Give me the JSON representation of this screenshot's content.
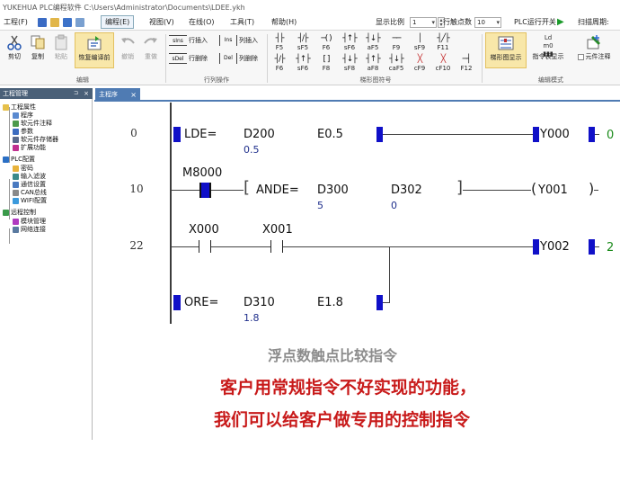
{
  "window": {
    "title": "YUKEHUA PLC编程软件 C:\\Users\\Administrator\\Documents\\LDEE.ykh"
  },
  "menu": {
    "items": [
      "工程(F)",
      "编程(E)",
      "视图(V)",
      "在线(O)",
      "工具(T)",
      "帮助(H)"
    ],
    "display_ratio_label": "显示比例",
    "display_ratio_value": "1",
    "row_points_label": "行触点数",
    "row_points_value": "10",
    "plc_switch_label": "PLC运行开关",
    "scan_cycle_label": "扫描周期:"
  },
  "ribbon": {
    "edit": {
      "cut": "剪切",
      "copy": "复制",
      "paste": "粘贴",
      "restore": "恢复编译前",
      "undo": "撤销",
      "redo": "重做",
      "group": "编辑"
    },
    "row_ops": {
      "row_insert": "行插入",
      "row_delete": "行删除",
      "col_insert": "列插入",
      "col_delete": "列删除",
      "ins_code1": "sIns",
      "del_code1": "sDel",
      "ins_code2": "Ins",
      "del_code2": "Del",
      "group": "行列操作"
    },
    "ladder": {
      "row1": [
        "F5",
        "sF5",
        "F6",
        "sF6",
        "aF5",
        "F9",
        "sF9",
        "F11"
      ],
      "row1_glyphs": [
        "┤├",
        "┤/├",
        "─( )",
        "┤↑├",
        "┤↓├",
        "──",
        "│",
        "┤╱├"
      ],
      "row2": [
        "F6",
        "sF6",
        "F8",
        "sF8",
        "aF8",
        "caF5",
        "cF9",
        "cF10",
        "F12"
      ],
      "row2_glyphs": [
        "┤/├",
        "┤↑├",
        "[ ]",
        "┤↓├",
        "┤↑├",
        "┤↓├",
        "╳",
        "╳",
        "─┤"
      ],
      "group": "梯形图符号"
    },
    "mode": {
      "ladder_display": "梯形图显示",
      "instr_display": "指令表显示",
      "comment_check": "元件注释",
      "ld_code": "Ld m0",
      "group": "编辑模式"
    }
  },
  "panel": {
    "title": "工程管理",
    "tree": [
      {
        "label": "工程属性",
        "indent": 0
      },
      {
        "label": "程序",
        "indent": 1
      },
      {
        "label": "软元件注释",
        "indent": 1
      },
      {
        "label": "参数",
        "indent": 1
      },
      {
        "label": "软元件存储器",
        "indent": 1
      },
      {
        "label": "扩展功能",
        "indent": 1
      },
      {
        "label": "PLC配置",
        "indent": 0
      },
      {
        "label": "密码",
        "indent": 1
      },
      {
        "label": "输入滤波",
        "indent": 1
      },
      {
        "label": "通信设置",
        "indent": 1
      },
      {
        "label": "CAN总线",
        "indent": 1
      },
      {
        "label": "WIFI配置",
        "indent": 1
      },
      {
        "label": "远程控制",
        "indent": 0
      },
      {
        "label": "模块管理",
        "indent": 1
      },
      {
        "label": "网络连接",
        "indent": 1
      }
    ]
  },
  "tabs": {
    "main": "主程序"
  },
  "ladder": {
    "rung1": {
      "step": "0",
      "instr": "LDE=",
      "op1": "D200",
      "op1_val": "0.5",
      "op2": "E0.5",
      "coil": "Y000",
      "state": "0"
    },
    "rung2": {
      "step": "10",
      "contact": "M8000",
      "instr": "ANDE=",
      "op1": "D300",
      "op1_val": "5",
      "op2": "D302",
      "op2_val": "0",
      "coil": "Y001"
    },
    "rung3": {
      "step": "22",
      "contact1": "X000",
      "contact2": "X001",
      "coil": "Y002",
      "state": "2",
      "instr": "ORE=",
      "op1": "D310",
      "op1_val": "1.8",
      "op2": "E1.8"
    }
  },
  "captions": {
    "line1": "浮点数触点比较指令",
    "line2": "客户用常规指令不好实现的功能，",
    "line3": "我们可以给客户做专用的控制指令"
  },
  "colors": {
    "accent": "#4f7bb3",
    "instr_block": "#1010c8",
    "caption_red": "#c81a1a",
    "caption_gray": "#8c8c8c",
    "state_green": "#1a8a1a"
  }
}
